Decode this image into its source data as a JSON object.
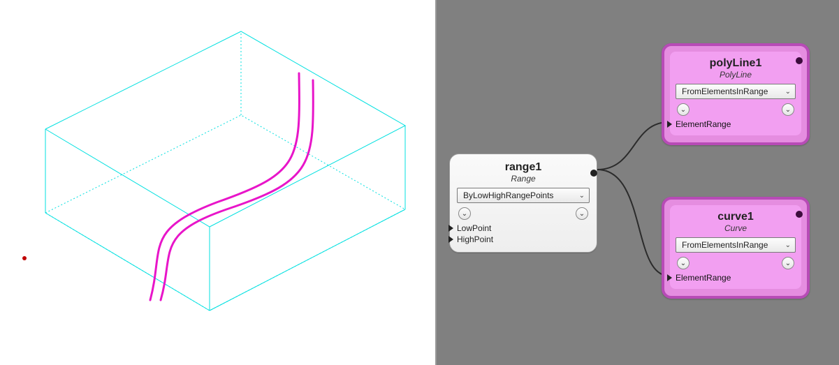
{
  "viewport": {
    "box_color": "#00e0e0",
    "curve_color": "#e815c9",
    "origin_dot_color": "#c00000"
  },
  "graph": {
    "nodes": {
      "range1": {
        "title": "range1",
        "subtitle": "Range",
        "dropdown": "ByLowHighRangePoints",
        "ports_in": [
          "LowPoint",
          "HighPoint"
        ]
      },
      "polyLine1": {
        "title": "polyLine1",
        "subtitle": "PolyLine",
        "dropdown": "FromElementsInRange",
        "ports_in": [
          "ElementRange"
        ]
      },
      "curve1": {
        "title": "curve1",
        "subtitle": "Curve",
        "dropdown": "FromElementsInRange",
        "ports_in": [
          "ElementRange"
        ]
      }
    }
  }
}
